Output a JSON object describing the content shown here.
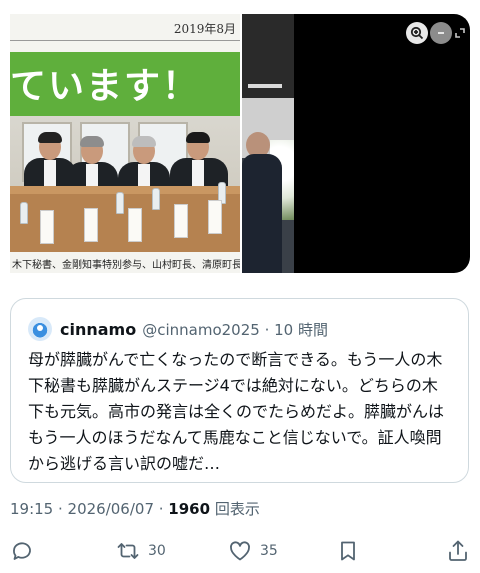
{
  "media": {
    "left_image": {
      "clipping_date": "2019年8月",
      "banner_text": "ています！",
      "caption": "木下秘書、金剛知事特別参与、山村町長、清原町長"
    },
    "right_image": {
      "controls": [
        "zoom-in-icon",
        "minimize-icon",
        "expand-icon"
      ]
    }
  },
  "quoted_tweet": {
    "avatar_icon": "avatar",
    "display_name": "cinnamo",
    "handle_time": "@cinnamo2025 · 10 時間",
    "text": "母が膵臓がんで亡くなったので断言できる。もう一人の木下秘書も膵臓がんステージ4では絶対にない。どちらの木下も元気。高市の発言は全くのでたらめだよ。膵臓がんはもう一人のほうだなんて馬鹿なこと信じないで。証人喚問から逃げる言い訳の嘘だ…"
  },
  "meta": {
    "timestamp": "19:15 · 2026/06/07 · ",
    "views_count": "1960",
    "views_label": " 回表示"
  },
  "actions": {
    "reply": {
      "icon": "reply-icon",
      "count": ""
    },
    "repost": {
      "icon": "repost-icon",
      "count": "30"
    },
    "like": {
      "icon": "heart-icon",
      "count": "35"
    },
    "bookmark": {
      "icon": "bookmark-icon",
      "count": ""
    },
    "share": {
      "icon": "share-icon",
      "count": ""
    }
  },
  "colors": {
    "text_primary": "#0f1419",
    "text_secondary": "#536471",
    "border": "#cfd9de",
    "banner_green": "#5faf3c"
  }
}
